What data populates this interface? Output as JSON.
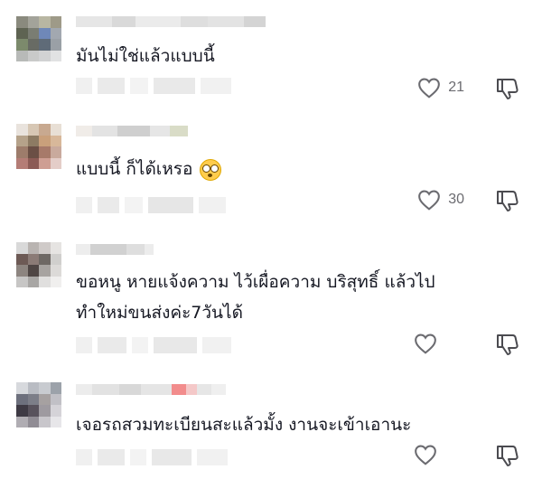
{
  "comments": [
    {
      "text": "มันไม่ใช่แล้วแบบนี้",
      "likes": "21",
      "avatar_colors": [
        "#8a8a7e",
        "#a3a39a",
        "#b8b6a2",
        "#9e9a88",
        "#5e6352",
        "#7a7d73",
        "#6f88b8",
        "#a2a8b0",
        "#7c8a6c",
        "#686b64",
        "#5f6b78",
        "#9aa0a6",
        "#b8bab8",
        "#c9cac9",
        "#d1d2d3",
        "#e1e2e3"
      ],
      "like_icon": "heart-outline-icon",
      "dislike_icon": "thumbs-down-outline-icon"
    },
    {
      "text": "แบบนี้ ก็ได้เหรอ",
      "emoji": "flushed-face-emoji",
      "likes": "30",
      "avatar_colors": [
        "#e9e3dd",
        "#d7c7b4",
        "#c8a990",
        "#e8dfd5",
        "#b5a28a",
        "#8d7b63",
        "#c9a07b",
        "#d8b89a",
        "#9d7c6b",
        "#6b4f45",
        "#a77a6a",
        "#c9aa9d",
        "#b47d76",
        "#8c5b55",
        "#ce9e93",
        "#e4cdc8"
      ],
      "like_icon": "heart-outline-icon",
      "dislike_icon": "thumbs-down-outline-icon"
    },
    {
      "text_lines": [
        "ขอหนู หายแจ้งความ ไว้เผื่อความ บริสุทธิ์ แล้วไป",
        "ทำใหม่ขนส่งค่ะ7วันได้"
      ],
      "avatar_colors": [
        "#d9d9d9",
        "#b9b4b1",
        "#cfcac8",
        "#e6e4e2",
        "#6d5a55",
        "#8b7b76",
        "#6e6864",
        "#d0cfcd",
        "#8d8580",
        "#4f4644",
        "#a7a3a0",
        "#dcdad8",
        "#c7c6c5",
        "#a8a6a4",
        "#e0dfde",
        "#f0efee"
      ],
      "like_icon": "heart-outline-icon",
      "dislike_icon": "thumbs-down-outline-icon"
    },
    {
      "text": "เจอรถสวมทะเบียนสะแล้วมั้ง งานจะเข้าเอานะ",
      "avatar_colors": [
        "#d7d9dd",
        "#b9bcc3",
        "#c8cbd0",
        "#9ca2aa",
        "#6d707d",
        "#7c7e88",
        "#a6a1a1",
        "#c1c0c6",
        "#3e3a44",
        "#58525c",
        "#9e9aa0",
        "#d5d3d8",
        "#b0adb3",
        "#908c94",
        "#c8c6cb",
        "#e7e6e9"
      ],
      "like_icon": "heart-outline-icon",
      "dislike_icon": "thumbs-down-outline-icon"
    }
  ]
}
